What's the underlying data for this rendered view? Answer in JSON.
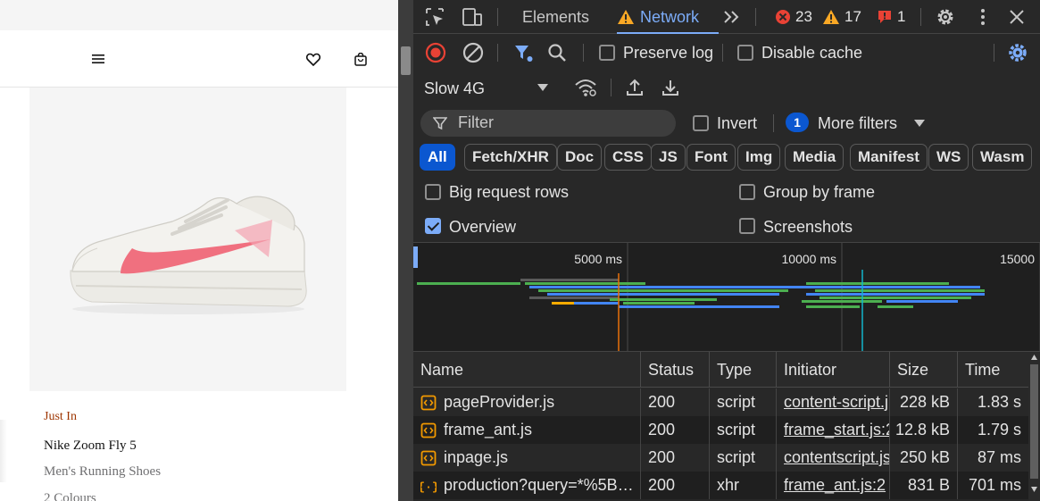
{
  "page": {
    "label_new": "Just In",
    "product_name": "Nike Zoom Fly 5",
    "product_subtitle": "Men's Running Shoes",
    "product_colours": "2 Colours"
  },
  "devtools": {
    "tabs": [
      "Elements",
      "Network"
    ],
    "active_tab": "Network",
    "counts": {
      "errors": "23",
      "warnings": "17",
      "issues": "1"
    },
    "toolbar": {
      "preserve_log": "Preserve log",
      "disable_cache": "Disable cache",
      "throttle": "Slow 4G"
    },
    "filter": {
      "placeholder": "Filter",
      "invert": "Invert",
      "more_filters_count": "1",
      "more_filters": "More filters"
    },
    "types": [
      "All",
      "Fetch/XHR",
      "Doc",
      "CSS",
      "JS",
      "Font",
      "Img",
      "Media",
      "Manifest",
      "WS",
      "Wasm"
    ],
    "options": {
      "big_request_rows": "Big request rows",
      "group_by_frame": "Group by frame",
      "overview": "Overview",
      "screenshots": "Screenshots"
    },
    "overview_ticks": [
      "5000 ms",
      "10000 ms",
      "15000"
    ],
    "columns": [
      "Name",
      "Status",
      "Type",
      "Initiator",
      "Size",
      "Time"
    ],
    "rows": [
      {
        "name": "pageProvider.js",
        "status": "200",
        "type": "script",
        "initiator": "content-script.j",
        "size": "228 kB",
        "time": "1.83 s",
        "icon": "script-icon"
      },
      {
        "name": "frame_ant.js",
        "status": "200",
        "type": "script",
        "initiator": "frame_start.js:2",
        "size": "12.8 kB",
        "time": "1.79 s",
        "icon": "script-icon"
      },
      {
        "name": "inpage.js",
        "status": "200",
        "type": "script",
        "initiator": "contentscript.js",
        "size": "250 kB",
        "time": "87 ms",
        "icon": "script-icon"
      },
      {
        "name": "production?query=*%5B…",
        "status": "200",
        "type": "xhr",
        "initiator": "frame_ant.js:2",
        "size": "831 B",
        "time": "701 ms",
        "icon": "json-icon"
      }
    ]
  }
}
